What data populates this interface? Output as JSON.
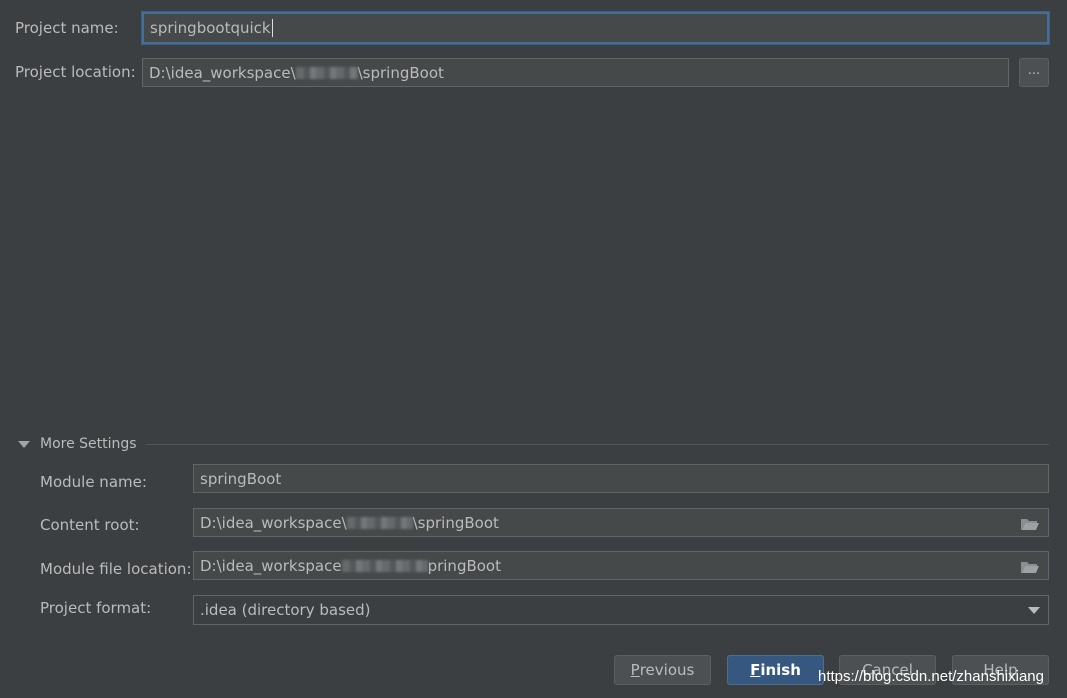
{
  "project": {
    "name_label": "Project name:",
    "name_value": "springbootquick",
    "location_label": "Project location:",
    "location_prefix": "D:\\idea_workspace\\",
    "location_suffix": "\\springBoot",
    "browse_label": "..."
  },
  "more_settings": {
    "header": "More Settings",
    "module_name_label": "Module name:",
    "module_name_value": "springBoot",
    "content_root_label": "Content root:",
    "content_root_prefix": "D:\\idea_workspace\\",
    "content_root_suffix": "\\springBoot",
    "module_file_label": "Module file location:",
    "module_file_prefix": "D:\\idea_workspace",
    "module_file_suffix": "pringBoot",
    "project_format_label": "Project format:",
    "project_format_value": ".idea (directory based)"
  },
  "buttons": {
    "previous_mnemonic": "P",
    "previous_rest": "revious",
    "finish_mnemonic": "F",
    "finish_rest": "inish",
    "cancel": "Cancel",
    "help": "Help"
  },
  "watermark": "https://blog.csdn.net/zhanshixiang",
  "icons": {
    "browse": "ellipsis",
    "folder": "folder-icon",
    "collapse": "triangle-down-icon",
    "dropdown": "chevron-down-icon"
  },
  "colors": {
    "background": "#3c3f41",
    "field": "#45494a",
    "focus_border": "#466d94",
    "default_button": "#365880"
  }
}
